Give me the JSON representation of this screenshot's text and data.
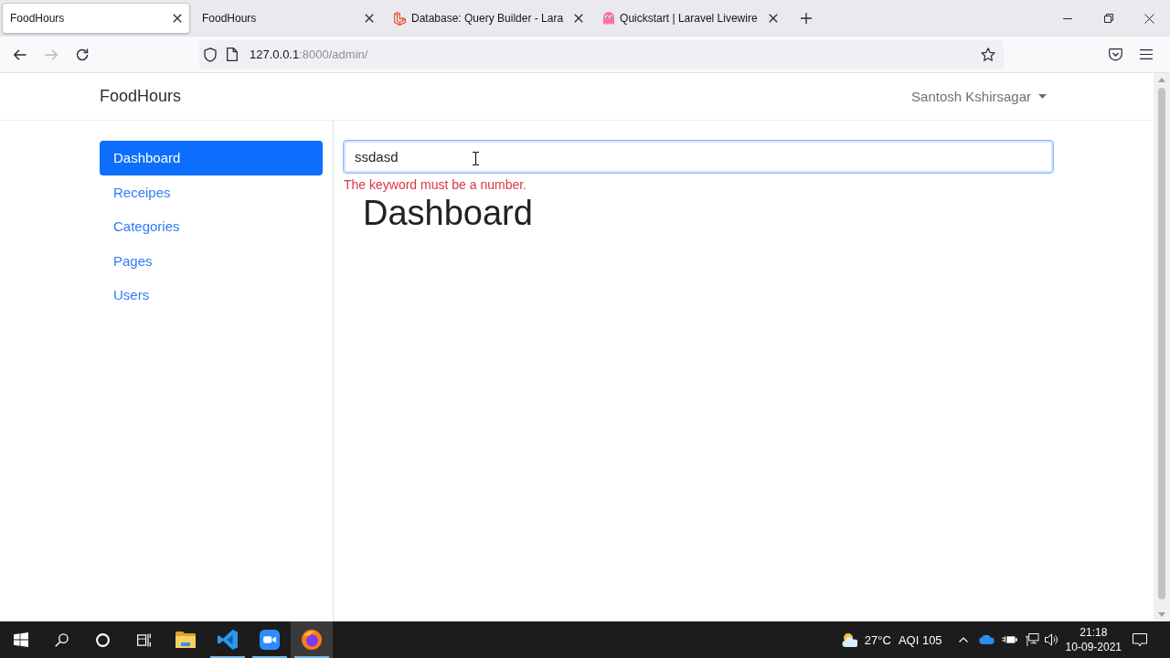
{
  "browser": {
    "tabs": [
      {
        "title": "FoodHours",
        "kind": "plain",
        "selected": true
      },
      {
        "title": "FoodHours",
        "kind": "plain",
        "selected": false
      },
      {
        "title": "Database: Query Builder - Lara",
        "kind": "cube",
        "selected": false
      },
      {
        "title": "Quickstart | Laravel Livewire",
        "kind": "ghost",
        "selected": false
      }
    ],
    "nav_buttons": [
      {
        "kind": "back",
        "disabled": false
      },
      {
        "kind": "forward",
        "disabled": true
      },
      {
        "kind": "reload",
        "disabled": false
      }
    ],
    "address": {
      "host": "127.0.0.1",
      "path": ":8000/admin/"
    }
  },
  "page": {
    "brand": "FoodHours",
    "user_menu": "Santosh Kshirsagar",
    "sidebar": [
      {
        "label": "Dashboard",
        "selected": true
      },
      {
        "label": "Receipes",
        "selected": false
      },
      {
        "label": "Categories",
        "selected": false
      },
      {
        "label": "Pages",
        "selected": false
      },
      {
        "label": "Users",
        "selected": false
      }
    ],
    "keyword_field": {
      "value": "ssdasd",
      "focused": true
    },
    "error": "The keyword must be a number.",
    "heading": "Dashboard"
  },
  "taskbar": {
    "apps": [
      {
        "kind": "folder",
        "running": false,
        "active": false
      },
      {
        "kind": "code",
        "running": true,
        "active": false
      },
      {
        "kind": "video",
        "running": true,
        "active": false
      },
      {
        "kind": "browser",
        "running": true,
        "active": true
      }
    ],
    "weather": {
      "temperature": "27°C",
      "aqi": "AQI 105"
    },
    "clock": {
      "time": "21:18",
      "date": "10-09-2021"
    }
  }
}
